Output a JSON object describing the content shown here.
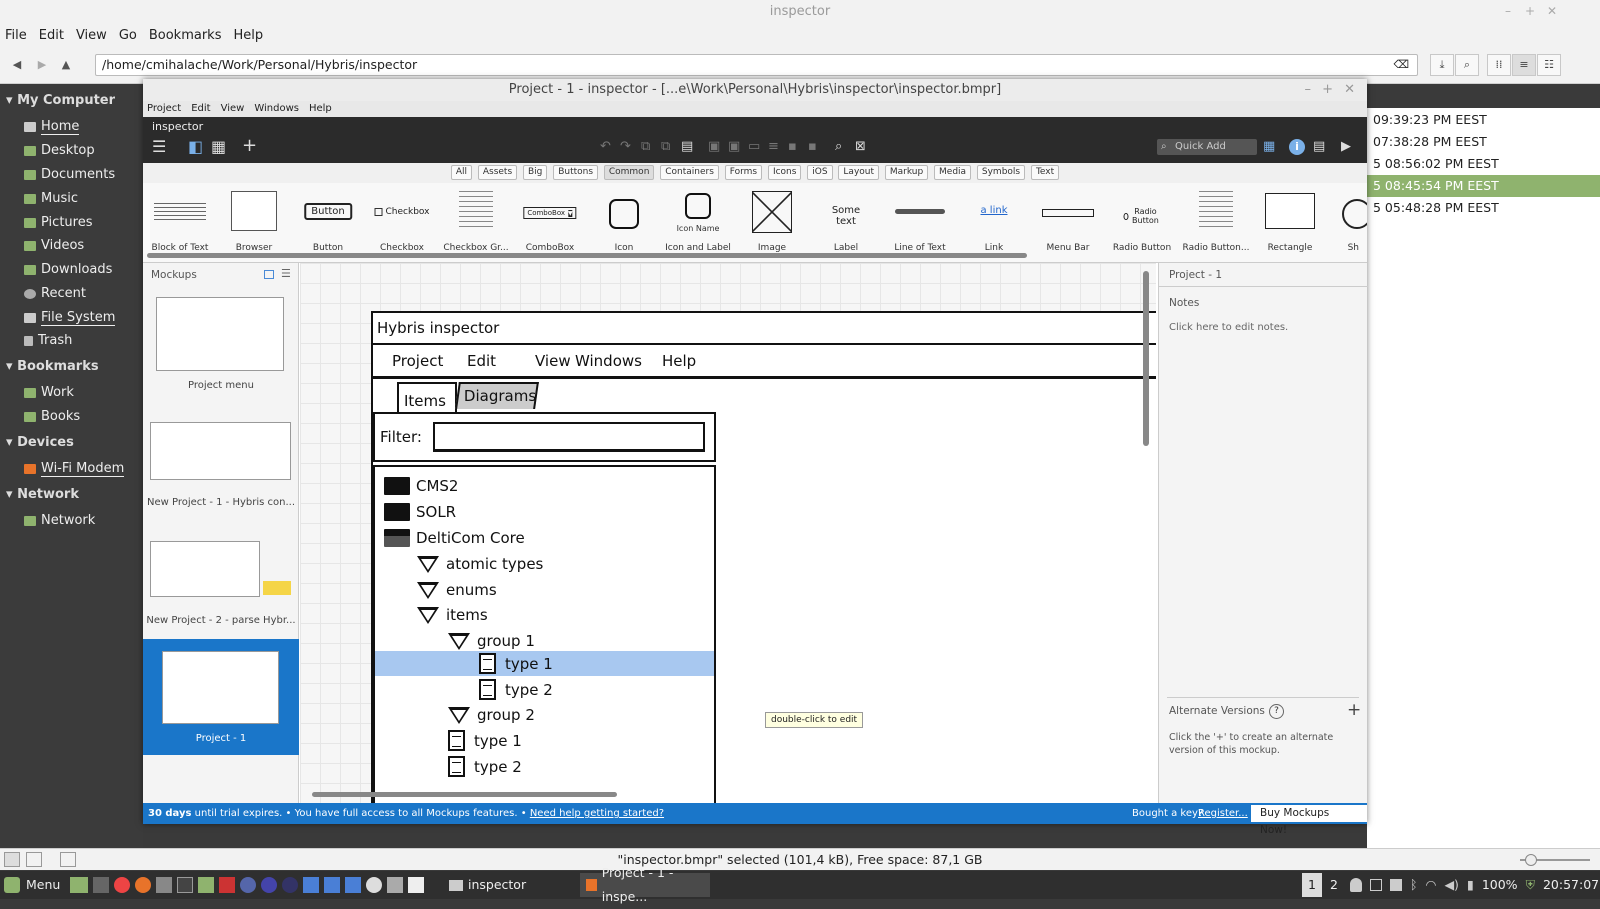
{
  "desktop": {
    "title": "inspector",
    "menu": [
      "File",
      "Edit",
      "View",
      "Go",
      "Bookmarks",
      "Help"
    ],
    "path": "/home/cmihalache/Work/Personal/Hybris/inspector",
    "sidebar": {
      "sections": [
        {
          "title": "My Computer",
          "items": [
            "Home",
            "Desktop",
            "Documents",
            "Music",
            "Pictures",
            "Videos",
            "Downloads",
            "Recent",
            "File System",
            "Trash"
          ]
        },
        {
          "title": "Bookmarks",
          "items": [
            "Work",
            "Books"
          ]
        },
        {
          "title": "Devices",
          "items": [
            "Wi-Fi Modem"
          ]
        },
        {
          "title": "Network",
          "items": [
            "Network"
          ]
        }
      ]
    },
    "file_times": [
      "09:39:23 PM EEST",
      "07:38:28 PM EEST",
      "5 08:56:02 PM EEST",
      "5 08:45:54 PM EEST",
      "5 05:48:28 PM EEST"
    ],
    "status": "\"inspector.bmpr\" selected (101,4 kB), Free space: 87,1 GB",
    "taskbar": {
      "menu": "Menu",
      "app1": "inspector",
      "app2": "Project - 1 - inspe...",
      "ws1": "1",
      "ws2": "2",
      "battery": "100%",
      "time": "20:57:07"
    }
  },
  "app": {
    "title": "Project - 1 - inspector - [...e\\Work\\Personal\\Hybris\\inspector\\inspector.bmpr]",
    "menu": [
      "Project",
      "Edit",
      "View",
      "Windows",
      "Help"
    ],
    "project_name": "inspector",
    "quick_add": "Quick Add",
    "filters": [
      "All",
      "Assets",
      "Big",
      "Buttons",
      "Common",
      "Containers",
      "Forms",
      "Icons",
      "iOS",
      "Layout",
      "Markup",
      "Media",
      "Symbols",
      "Text"
    ],
    "active_filter": "Common",
    "library": [
      {
        "label": "Block of Text",
        "thumb": ""
      },
      {
        "label": "Browser",
        "thumb": ""
      },
      {
        "label": "Button",
        "thumb": "Button"
      },
      {
        "label": "Checkbox",
        "thumb": "Checkbox"
      },
      {
        "label": "Checkbox Gr...",
        "thumb": ""
      },
      {
        "label": "ComboBox",
        "thumb": "ComboBox"
      },
      {
        "label": "Icon",
        "thumb": ""
      },
      {
        "label": "Icon and Label",
        "thumb": "Icon Name"
      },
      {
        "label": "Image",
        "thumb": ""
      },
      {
        "label": "Label",
        "thumb": "Some text"
      },
      {
        "label": "Line of Text",
        "thumb": ""
      },
      {
        "label": "Link",
        "thumb": "a link"
      },
      {
        "label": "Menu Bar",
        "thumb": ""
      },
      {
        "label": "Radio Button",
        "thumb": "Radio Button"
      },
      {
        "label": "Radio Button...",
        "thumb": ""
      },
      {
        "label": "Rectangle",
        "thumb": ""
      },
      {
        "label": "Sh",
        "thumb": ""
      }
    ],
    "mockups_header": "Mockups",
    "mockups": [
      "Project menu",
      "New Project - 1 - Hybris con...",
      "New Project - 2 - parse Hybr...",
      "Project - 1"
    ],
    "mockup": {
      "window_title": "Hybris inspector",
      "menu": [
        "Project",
        "Edit",
        "View",
        "Windows",
        "Help"
      ],
      "tabs": [
        "Items",
        "Diagrams"
      ],
      "filter_label": "Filter:",
      "tree": [
        "CMS2",
        "SOLR",
        "DeltiCom Core",
        "atomic types",
        "enums",
        "items",
        "group 1",
        "type 1",
        "type 2",
        "group 2",
        "type 1",
        "type 2"
      ],
      "tooltip": "double-click to edit"
    },
    "right_panel": {
      "project": "Project - 1",
      "notes_label": "Notes",
      "notes_hint": "Click here to edit notes.",
      "alt_label": "Alternate Versions",
      "alt_hint": "Click the '+' to create an alternate version of this mockup."
    },
    "trial": {
      "days": "30 days",
      "text": " until trial expires. • You have full access to all Mockups features. • ",
      "link": "Need help getting started?",
      "key_q": "Bought a key?",
      "register": "Register...",
      "buy": "Buy Mockups Now!"
    }
  }
}
